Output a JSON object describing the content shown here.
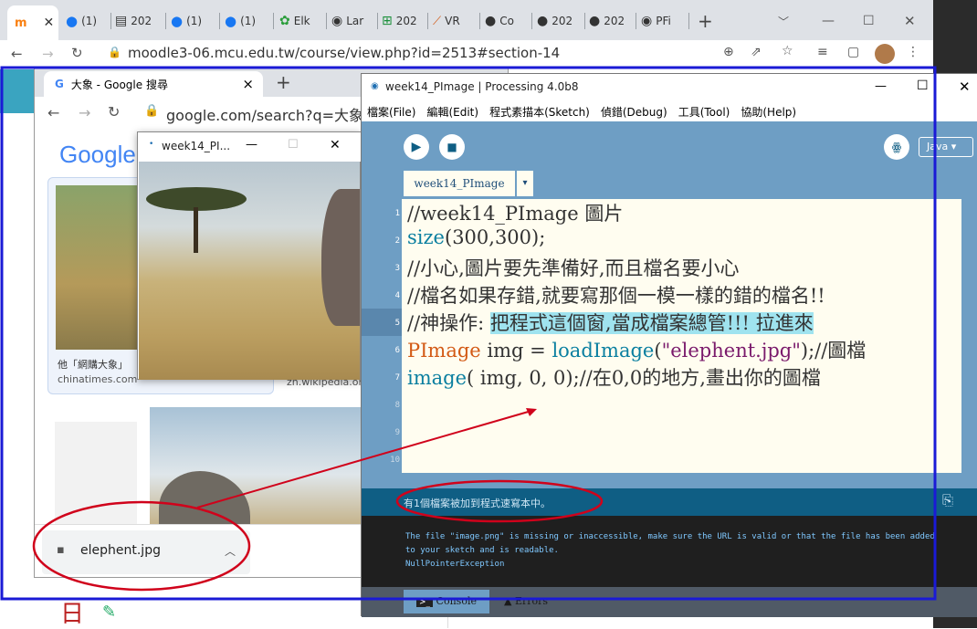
{
  "outer_browser": {
    "tabs": [
      "(1)",
      "202",
      "(1)",
      "(1)",
      "Elk",
      "Lar",
      "202",
      "VR",
      "Co",
      "202",
      "202",
      "PFi"
    ],
    "new_tab": "+",
    "url": "moodle3-06.mcu.edu.tw/course/view.php?id=2513#section-14"
  },
  "inner_browser": {
    "tab_title": "大象 - Google 搜尋",
    "tab_close": "×",
    "new_tab": "+",
    "url": "google.com/search?q=大象&tbm",
    "logo": "Google",
    "result_caption": "他「網購大象」",
    "result_source_1": "chinatimes.com",
    "result_source_2": "zh.wikipedia.or",
    "download_file": "elephent.jpg",
    "page_heading_fragment": "日"
  },
  "small_window": {
    "title": "week14_PI...",
    "minimize": "—",
    "maximize": "☐",
    "close": "✕"
  },
  "processing": {
    "title": "week14_PImage | Processing 4.0b8",
    "minimize": "—",
    "maximize": "☐",
    "close": "✕",
    "menu": [
      "檔案(File)",
      "編輯(Edit)",
      "程式素描本(Sketch)",
      "偵錯(Debug)",
      "工具(Tool)",
      "協助(Help)"
    ],
    "mode": "Java ▾",
    "tab": "week14_PImage",
    "tab_arrow": "▾",
    "line_numbers": [
      "1",
      "2",
      "3",
      "4",
      "5",
      "6",
      "7",
      "8",
      "9",
      "10"
    ],
    "code": {
      "l1": "//week14_PImage 圖片",
      "l2a": "size",
      "l2b": "(300,300);",
      "l3": "//小心,圖片要先準備好,而且檔名要小心",
      "l4": "//檔名如果存錯,就要寫那個一模一樣的錯的檔名!!",
      "l5a": "//神操作: ",
      "l5b": "把程式這個窗,當成檔案總管!!! 拉進來",
      "l6a": "PImage",
      "l6b": " img = ",
      "l6c": "loadImage",
      "l6d": "(",
      "l6e": "\"elephent.jpg\"",
      "l6f": ");//圖檔",
      "l7a": "image",
      "l7b": "( img, 0, 0);//在0,0的地方,畫出你的圖檔"
    },
    "status": "有1個檔案被加到程式速寫本中。",
    "console_lines": [
      "The file \"image.png\" is missing or inaccessible, make sure the URL is valid or that the file has been added",
      "to your sketch and is readable.",
      "NullPointerException"
    ],
    "console_tab": "Console",
    "errors_tab": "Errors"
  },
  "colors": {
    "annotation_red": "#d0021b",
    "annotation_blue": "#1a1ad6",
    "processing_blue": "#6e9ec4",
    "editor_bg": "#fffdf0"
  }
}
